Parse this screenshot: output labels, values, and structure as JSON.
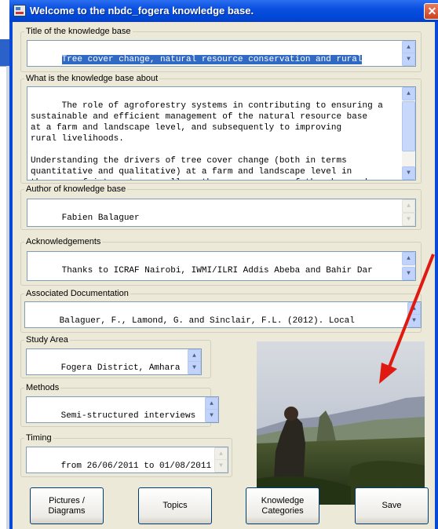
{
  "window": {
    "title": "Welcome to the nbdc_fogera knowledge base.",
    "close_glyph": "✕"
  },
  "fields": {
    "title": {
      "label": "Title of the knowledge base",
      "value": "Tree cover change, natural resource conservation and rural"
    },
    "about": {
      "label": "What is the knowledge base about",
      "value": "The role of agroforestry systems in contributing to ensuring a\nsustainable and efficient management of the natural resource base\nat a farm and landscape level, and subsequently to improving\nrural livelihoods.\n\nUnderstanding the drivers of tree cover change (both in terms\nquantitative and qualitative) at a farm and landscape level in\nthe area of interest, as well as the consequences of the observed"
    },
    "author": {
      "label": "Author of knowledge base",
      "value": "Fabien Balaguer"
    },
    "acknowledgements": {
      "label": "Acknowledgements",
      "value": "Thanks to ICRAF Nairobi, IWMI/ILRI Addis Abeba and Bahir Dar"
    },
    "documentation": {
      "label": "Associated Documentation",
      "value": "Balaguer, F., Lamond, G. and Sinclair, F.L. (2012). Local"
    },
    "study_area": {
      "label": "Study Area",
      "value": "Fogera District, Amhara"
    },
    "methods": {
      "label": "Methods",
      "value": "Semi-structured interviews"
    },
    "timing": {
      "label": "Timing",
      "value": "from 26/06/2011 to 01/08/2011"
    }
  },
  "buttons": {
    "pictures": "Pictures /\nDiagrams",
    "topics": "Topics",
    "categories": "Knowledge\nCategories",
    "save": "Save"
  },
  "scroll": {
    "up_glyph": "▲",
    "down_glyph": "▼"
  },
  "colors": {
    "title_bar": "#0046d5",
    "dialog_bg": "#ece9d8",
    "selection": "#316ac5",
    "annotation_arrow": "#e01a10"
  },
  "icons": {
    "window": "app-icon",
    "close": "close-icon",
    "annotation": "red-arrow-icon"
  }
}
